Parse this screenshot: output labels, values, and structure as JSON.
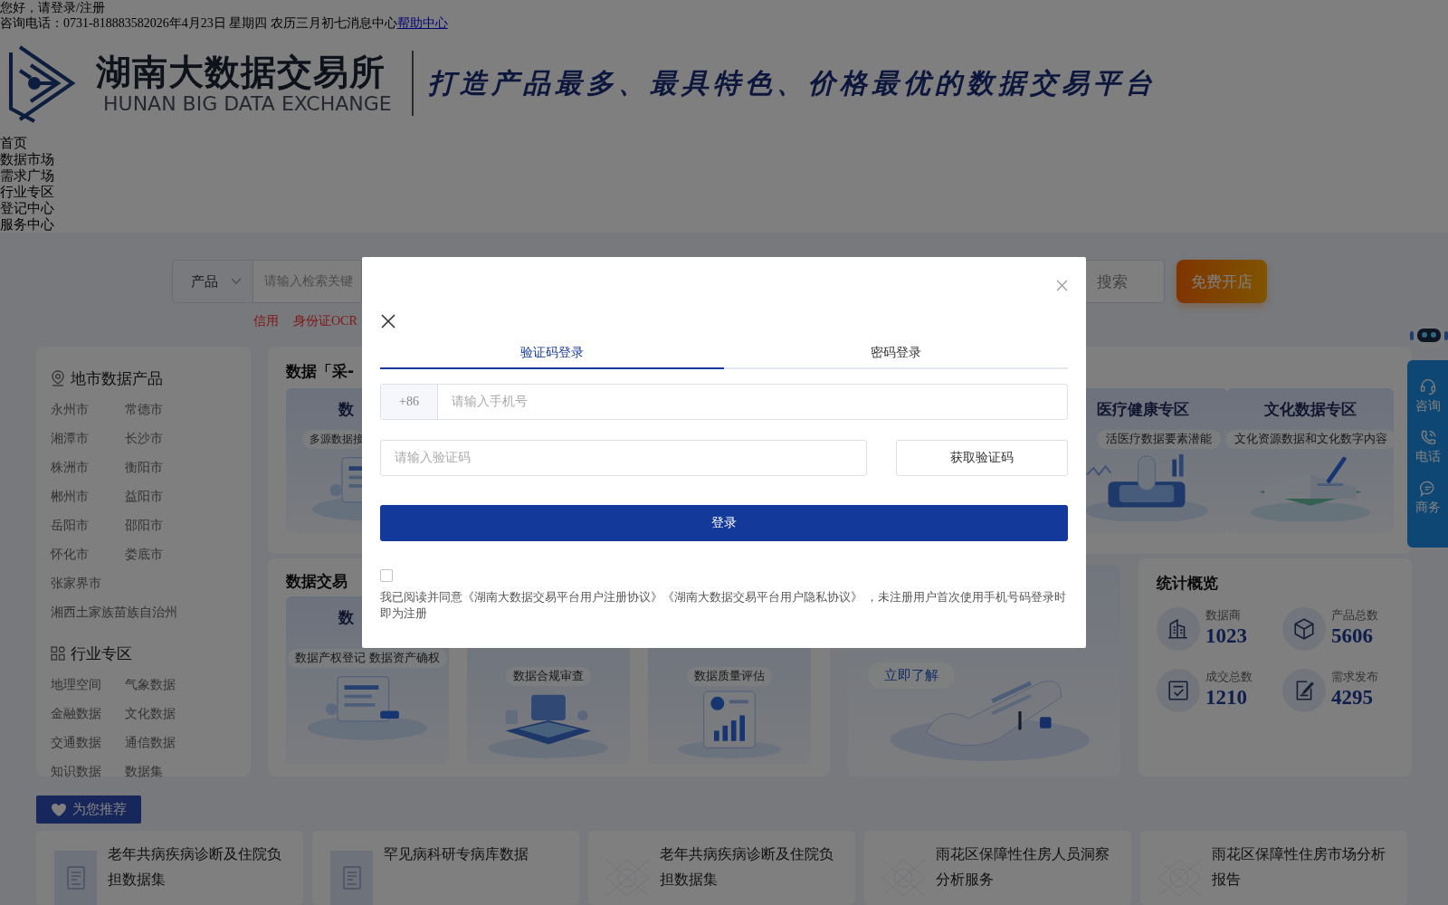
{
  "top_bar": {
    "greeting": "您好，请登录/注册",
    "hotline": "咨询电话：0731-81888358",
    "date": "2026年4月23日 星期四 农历三月初七",
    "messages": "消息中心",
    "help": "帮助中心"
  },
  "header": {
    "logo_title": "湖南大数据交易所",
    "logo_subtitle": "HUNAN BIG DATA EXCHANGE",
    "slogan": "打造产品最多、最具特色、价格最优的数据交易平台"
  },
  "nav": [
    "首页",
    "数据市场",
    "需求广场",
    "行业专区",
    "登记中心",
    "服务中心"
  ],
  "search": {
    "category": "产品",
    "placeholder": "请输入检索关键",
    "button": "搜索",
    "open_store": "免费开店",
    "hot_tags": [
      "信用",
      "身份证OCR"
    ]
  },
  "sidebar": {
    "sections": [
      {
        "kind": "region",
        "title": "地市数据产品",
        "items": [
          "永州市",
          "常德市",
          "湘潭市",
          "长沙市",
          "株洲市",
          "衡阳市",
          "郴州市",
          "益阳市",
          "岳阳市",
          "邵阳市",
          "怀化市",
          "娄底市",
          "张家界市",
          "湘西土家族苗族自治州"
        ]
      },
      {
        "kind": "industry",
        "title": "行业专区",
        "items": [
          "地理空间",
          "气象数据",
          "金融数据",
          "文化数据",
          "交通数据",
          "通信数据",
          "知识数据",
          "数据集"
        ]
      }
    ]
  },
  "zones": {
    "title": "数据「采-",
    "cards": [
      {
        "title": "数",
        "subtitle": "多源数据接"
      },
      {
        "title": "医疗健康专区",
        "subtitle": "活医疗数据要素潜能"
      },
      {
        "title": "文化数据专区",
        "subtitle": "文化资源数据和文化数字内容"
      }
    ]
  },
  "services": {
    "title": "数据交易",
    "cards": [
      {
        "title": "数",
        "subtitle": "数据产权登记 数据资产确权"
      },
      {
        "subtitle": "数据合规审查"
      },
      {
        "subtitle": "数据质量评估"
      }
    ]
  },
  "promo": {
    "button": "立即了解"
  },
  "stats": {
    "title": "统计概览",
    "items": [
      {
        "label": "数据商",
        "value": "1023"
      },
      {
        "label": "产品总数",
        "value": "5606"
      },
      {
        "label": "成交总数",
        "value": "1210"
      },
      {
        "label": "需求发布",
        "value": "4295"
      }
    ]
  },
  "float_bar": [
    "咨询",
    "电话",
    "商务"
  ],
  "recommend": {
    "title": "为您推荐",
    "items": [
      {
        "kind": "document",
        "title": "老年共病疾病诊断及住院负担数据集"
      },
      {
        "kind": "document",
        "title": "罕见病科研专病库数据"
      },
      {
        "kind": "pattern",
        "title": "老年共病疾病诊断及住院负担数据集"
      },
      {
        "kind": "pattern",
        "title": "雨花区保障性住房人员洞察分析服务"
      },
      {
        "kind": "pattern",
        "title": "雨花区保障性住房市场分析报告"
      }
    ]
  },
  "login": {
    "tabs": [
      {
        "label": "验证码登录",
        "selected": true
      },
      {
        "label": "密码登录",
        "selected": false
      }
    ],
    "country_code": "+86",
    "phone_placeholder": "请输入手机号",
    "code_placeholder": "请输入验证码",
    "send_code": "获取验证码",
    "submit": "登录",
    "agree_checked": false,
    "agreement": "我已阅读并同意《湖南大数据交易平台用户注册协议》《湖南大数据交易平台用户隐私协议》 ，未注册用户首次使用手机号码登录时即为注册"
  }
}
